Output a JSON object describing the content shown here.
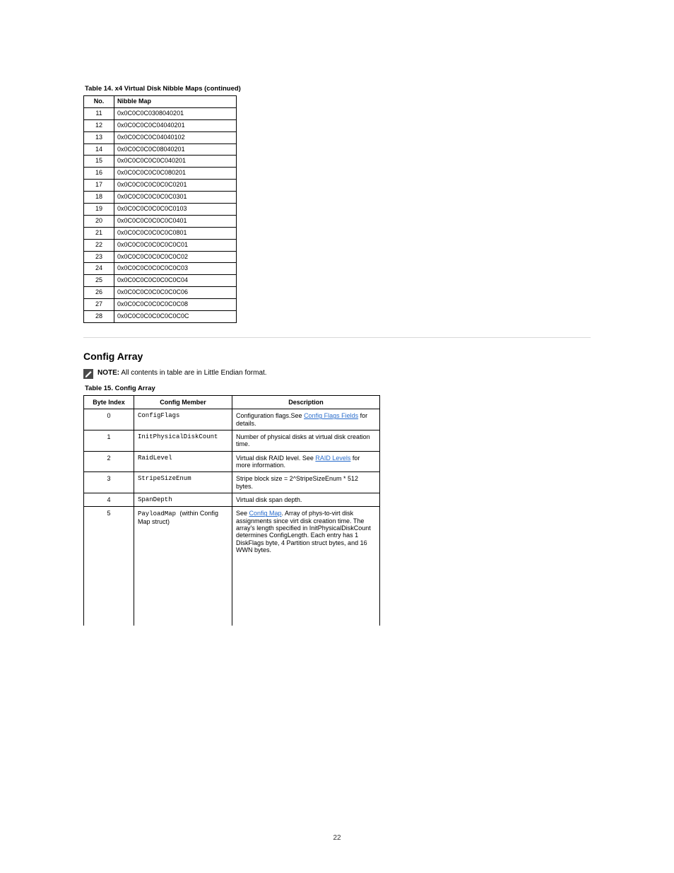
{
  "table14": {
    "caption": "Table 14. x4 Virtual Disk Nibble Maps (continued)",
    "headers": {
      "idx": "No.",
      "map": "Nibble Map"
    },
    "rows": [
      {
        "idx": "11",
        "map": "0x0C0C0C0308040201"
      },
      {
        "idx": "12",
        "map": "0x0C0C0C0C04040201"
      },
      {
        "idx": "13",
        "map": "0x0C0C0C0C04040102"
      },
      {
        "idx": "14",
        "map": "0x0C0C0C0C08040201"
      },
      {
        "idx": "15",
        "map": "0x0C0C0C0C0C040201"
      },
      {
        "idx": "16",
        "map": "0x0C0C0C0C0C080201"
      },
      {
        "idx": "17",
        "map": "0x0C0C0C0C0C0C0201"
      },
      {
        "idx": "18",
        "map": "0x0C0C0C0C0C0C0301"
      },
      {
        "idx": "19",
        "map": "0x0C0C0C0C0C0C0103"
      },
      {
        "idx": "20",
        "map": "0x0C0C0C0C0C0C0401"
      },
      {
        "idx": "21",
        "map": "0x0C0C0C0C0C0C0801"
      },
      {
        "idx": "22",
        "map": "0x0C0C0C0C0C0C0C01"
      },
      {
        "idx": "23",
        "map": "0x0C0C0C0C0C0C0C02"
      },
      {
        "idx": "24",
        "map": "0x0C0C0C0C0C0C0C03"
      },
      {
        "idx": "25",
        "map": "0x0C0C0C0C0C0C0C04"
      },
      {
        "idx": "26",
        "map": "0x0C0C0C0C0C0C0C06"
      },
      {
        "idx": "27",
        "map": "0x0C0C0C0C0C0C0C08"
      },
      {
        "idx": "28",
        "map": "0x0C0C0C0C0C0C0C0C"
      }
    ]
  },
  "config": {
    "title": "Config Array",
    "note_label": "NOTE:",
    "note_text": "All contents in table are in Little Endian format.",
    "caption": "Table 15. Config Array",
    "headers": {
      "idx": "Byte Index",
      "cfg": "Config Member",
      "dsc": "Description"
    },
    "rows": [
      {
        "idx": "0",
        "cfg": "ConfigFlags",
        "dsc_pre": "Configuration flags.",
        "dsc_link": "See ",
        "link": "Config Flags Fields",
        "dsc_post": " for details."
      },
      {
        "idx": "1",
        "cfg": "InitPhysicalDiskCount",
        "dsc_plain": "Number of physical disks at virtual disk creation time."
      },
      {
        "idx": "2",
        "cfg": "RaidLevel",
        "dsc_pre": "Virtual disk RAID level. ",
        "dsc_link": "See ",
        "link": "RAID Levels",
        "dsc_post": " for more information."
      },
      {
        "idx": "3",
        "cfg": "StripeSizeEnum",
        "dsc_plain": "Stripe block size = 2^StripeSizeEnum * 512 bytes."
      },
      {
        "idx": "4",
        "cfg": "SpanDepth",
        "dsc_plain": "Virtual disk span depth."
      },
      {
        "idx": "5",
        "cfg_span": true,
        "cfg": "PayloadMap",
        "cfg_sub": "(within Config Map struct)",
        "dsc_pre": "See ",
        "link": "Config Map",
        "dsc_post": ". Array of phys-to-virt disk assignments since virt disk creation time. The array's length specified in InitPhysicalDiskCount determines ConfigLength. Each entry has 1 DiskFlags byte, 4 Partition struct bytes, and 16 WWN bytes."
      }
    ]
  },
  "page_number": "22"
}
